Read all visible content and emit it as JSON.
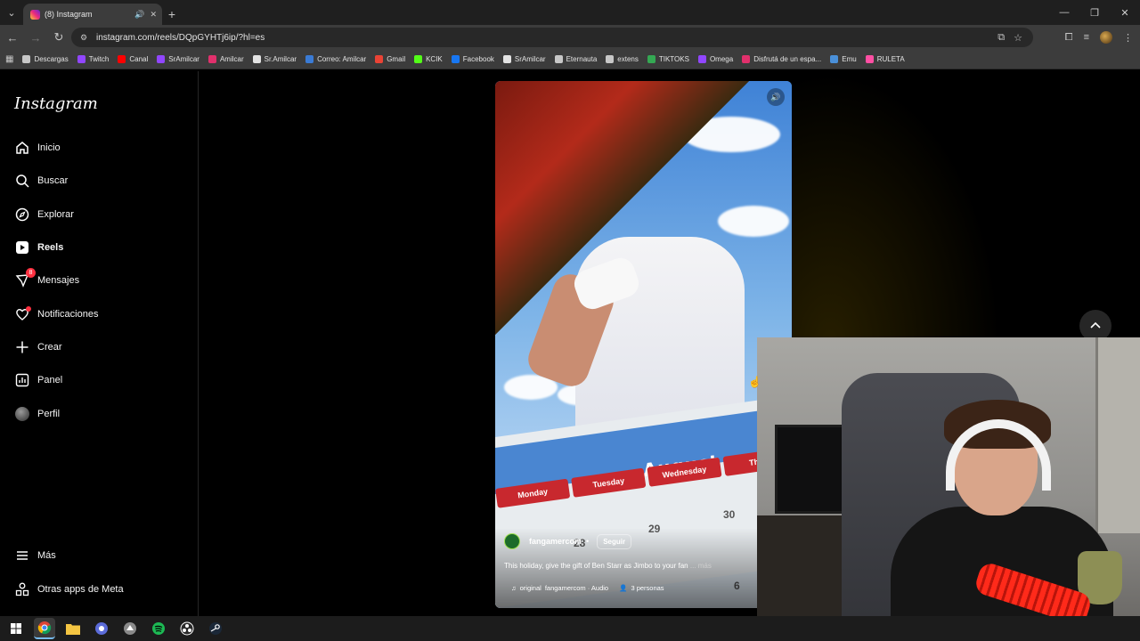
{
  "browser": {
    "tab": {
      "title": "(8) Instagram"
    },
    "address": "instagram.com/reels/DQpGYHTj6ip/?hl=es",
    "bookmarks": [
      {
        "label": "Descargas",
        "color": "#c7c7c7"
      },
      {
        "label": "Twitch",
        "color": "#9146ff"
      },
      {
        "label": "Canal",
        "color": "#ff0000"
      },
      {
        "label": "SrAmilcar",
        "color": "#9146ff"
      },
      {
        "label": "Amilcar",
        "color": "#e1306c"
      },
      {
        "label": "Sr.Amilcar",
        "color": "#e3e3e3"
      },
      {
        "label": "Correo: Amilcar",
        "color": "#3a7bd5"
      },
      {
        "label": "Gmail",
        "color": "#ea4335"
      },
      {
        "label": "KCIK",
        "color": "#53fc18"
      },
      {
        "label": "Facebook",
        "color": "#1877f2"
      },
      {
        "label": "SrAmilcar",
        "color": "#e3e3e3"
      },
      {
        "label": "Eternauta",
        "color": "#c7c7c7"
      },
      {
        "label": "extens",
        "color": "#c7c7c7"
      },
      {
        "label": "TIKTOKS",
        "color": "#34a853"
      },
      {
        "label": "Omega",
        "color": "#9146ff"
      },
      {
        "label": "Disfrutá de un espa...",
        "color": "#e1306c"
      },
      {
        "label": "Emu",
        "color": "#4a90d9"
      },
      {
        "label": "RULETA",
        "color": "#ff4fa3"
      }
    ]
  },
  "instagram": {
    "logo": "Instagram",
    "nav": [
      {
        "label": "Inicio",
        "icon": "home-icon"
      },
      {
        "label": "Buscar",
        "icon": "search-icon"
      },
      {
        "label": "Explorar",
        "icon": "compass-icon"
      },
      {
        "label": "Reels",
        "icon": "reels-icon"
      },
      {
        "label": "Mensajes",
        "icon": "messenger-icon",
        "badge": "8"
      },
      {
        "label": "Notificaciones",
        "icon": "heart-icon"
      },
      {
        "label": "Crear",
        "icon": "plus-icon"
      },
      {
        "label": "Panel",
        "icon": "dashboard-icon"
      },
      {
        "label": "Perfil",
        "icon": "profile-icon"
      }
    ],
    "more": "Más",
    "meta_apps": "Otras apps de Meta"
  },
  "reel": {
    "calendar_month": "August",
    "calendar_days": [
      "Monday",
      "Tuesday",
      "Wednesday",
      "Thurs"
    ],
    "calendar_numbers": [
      "28",
      "29",
      "30",
      "6"
    ],
    "author": "fangamercom",
    "follow_label": "Seguir",
    "caption": "This holiday, give the gift of Ben Starr as Jimbo to your fan",
    "caption_more": "... más",
    "audio_original": "original",
    "audio_label": "fangamercom · Audio",
    "people": "3 personas"
  }
}
